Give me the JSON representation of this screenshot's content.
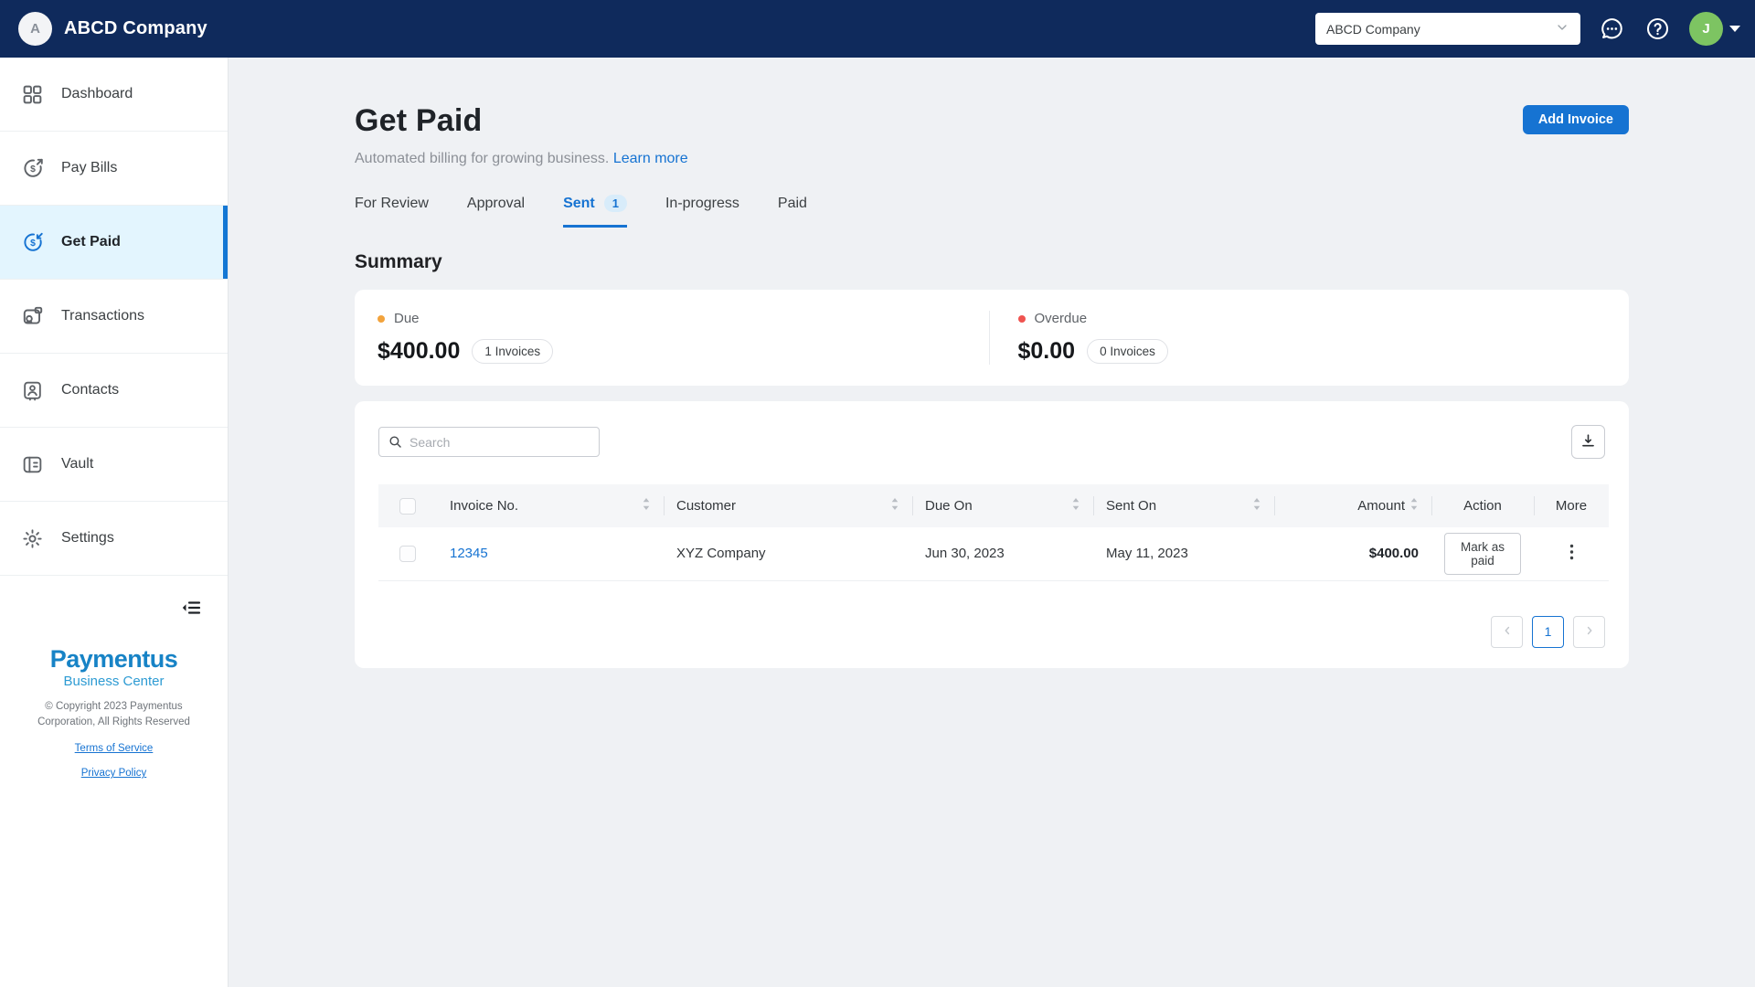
{
  "colors": {
    "navbar_bg": "#0f2a5c",
    "accent_blue": "#1673d2",
    "sidebar_active_bg": "#e3f5fe",
    "sidebar_active_bar": "#1377d4",
    "due_dot": "#f2a33c",
    "overdue_dot": "#ef5350",
    "user_avatar_green": "#7dc462",
    "paymentus_blue": "#1783c6",
    "paymentus_light_blue": "#2d9bd3"
  },
  "topbar": {
    "brand": {
      "avatar_letter": "A",
      "company_name": "ABCD Company"
    },
    "company_select": {
      "value": "ABCD Company",
      "icon": "chevron-down-icon"
    },
    "icons": [
      "chat-icon",
      "help-icon"
    ],
    "user": {
      "avatar_letter": "J",
      "icon": "caret-down-icon"
    }
  },
  "sidebar": {
    "items": [
      {
        "label": "Dashboard",
        "icon": "dashboard-icon",
        "active": false
      },
      {
        "label": "Pay Bills",
        "icon": "pay-bills-icon",
        "active": false
      },
      {
        "label": "Get Paid",
        "icon": "get-paid-icon",
        "active": true
      },
      {
        "label": "Transactions",
        "icon": "transactions-icon",
        "active": false
      },
      {
        "label": "Contacts",
        "icon": "contacts-icon",
        "active": false
      },
      {
        "label": "Vault",
        "icon": "vault-icon",
        "active": false
      },
      {
        "label": "Settings",
        "icon": "settings-icon",
        "active": false
      }
    ],
    "collapse_icon": "collapse-sidebar-icon",
    "footer": {
      "logo_title": "Paymentus",
      "logo_subtitle": "Business Center",
      "copyright_line1": "© Copyright 2023 Paymentus",
      "copyright_line2": "Corporation, All Rights Reserved",
      "links": [
        {
          "label": "Terms of Service"
        },
        {
          "label": "Privacy Policy"
        }
      ]
    }
  },
  "page": {
    "title": "Get Paid",
    "subtitle": "Automated billing for growing business.",
    "learn_more_label": "Learn more",
    "add_invoice_label": "Add Invoice",
    "tabs": [
      {
        "label": "For Review",
        "active": false
      },
      {
        "label": "Approval",
        "active": false
      },
      {
        "label": "Sent",
        "badge": "1",
        "active": true
      },
      {
        "label": "In-progress",
        "active": false
      },
      {
        "label": "Paid",
        "active": false
      }
    ],
    "summary": {
      "heading": "Summary",
      "cards": [
        {
          "label": "Due",
          "dot_color": "#f2a33c",
          "amount": "$400.00",
          "badge": "1 Invoices"
        },
        {
          "label": "Overdue",
          "dot_color": "#ef5350",
          "amount": "$0.00",
          "badge": "0 Invoices"
        }
      ]
    },
    "table": {
      "search_placeholder": "Search",
      "download_icon": "download-icon",
      "columns": [
        "Invoice No.",
        "Customer",
        "Due On",
        "Sent On",
        "Amount",
        "Action",
        "More"
      ],
      "rows": [
        {
          "invoice_no": "12345",
          "customer": "XYZ Company",
          "due_on": "Jun 30, 2023",
          "sent_on": "May 11, 2023",
          "amount": "$400.00",
          "action_label": "Mark as paid",
          "more_icon": "kebab-menu-icon"
        }
      ],
      "pagination": {
        "prev_icon": "chevron-left-icon",
        "current_page": "1",
        "next_icon": "chevron-right-icon"
      }
    }
  }
}
